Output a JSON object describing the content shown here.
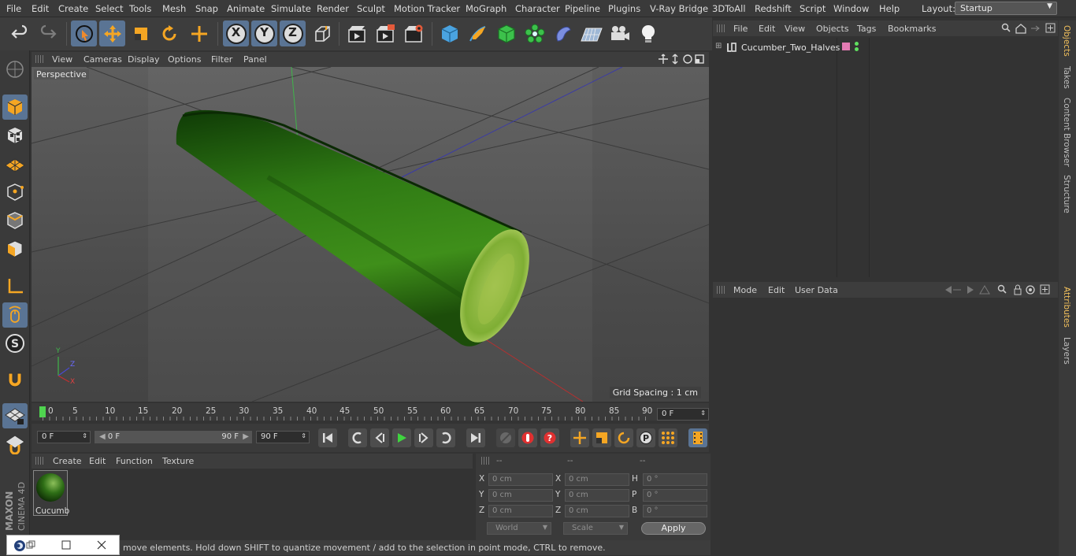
{
  "menubar": {
    "items": [
      "File",
      "Edit",
      "Create",
      "Select",
      "Tools",
      "Mesh",
      "Snap",
      "Animate",
      "Simulate",
      "Render",
      "Sculpt",
      "Motion Tracker",
      "MoGraph",
      "Character",
      "Pipeline",
      "Plugins",
      "V-Ray Bridge",
      "3DToAll",
      "Redshift",
      "Script",
      "Window",
      "Help"
    ],
    "layout_label": "Layout:",
    "layout_value": "Startup"
  },
  "toolbar": {
    "axis_x": "X",
    "axis_y": "Y",
    "axis_z": "Z"
  },
  "viewport": {
    "menu": [
      "View",
      "Cameras",
      "Display",
      "Options",
      "Filter",
      "Panel"
    ],
    "label": "Perspective",
    "grid_spacing": "Grid Spacing : 1 cm",
    "axis_x": "X",
    "axis_y": "Y",
    "axis_z": "Z"
  },
  "timeline": {
    "ticks": [
      "0",
      "5",
      "10",
      "15",
      "20",
      "25",
      "30",
      "35",
      "40",
      "45",
      "50",
      "55",
      "60",
      "65",
      "70",
      "75",
      "80",
      "85",
      "90"
    ],
    "current_frame": "0 F"
  },
  "transport": {
    "start_frame": "0 F",
    "range_start": "0 F",
    "range_end": "90 F",
    "end_frame": "90 F"
  },
  "material_manager": {
    "menu": [
      "Create",
      "Edit",
      "Function",
      "Texture"
    ],
    "material_name": "Cucumb"
  },
  "coordinates": {
    "headers": [
      "--",
      "--",
      "--"
    ],
    "rows": [
      {
        "l1": "X",
        "v1": "0 cm",
        "l2": "X",
        "v2": "0 cm",
        "l3": "H",
        "v3": "0 °"
      },
      {
        "l1": "Y",
        "v1": "0 cm",
        "l2": "Y",
        "v2": "0 cm",
        "l3": "P",
        "v3": "0 °"
      },
      {
        "l1": "Z",
        "v1": "0 cm",
        "l2": "Z",
        "v2": "0 cm",
        "l3": "B",
        "v3": "0 °"
      }
    ],
    "world": "World",
    "scale": "Scale",
    "apply": "Apply"
  },
  "status": "move elements. Hold down SHIFT to quantize movement / add to the selection in point mode, CTRL to remove.",
  "object_manager": {
    "menu": [
      "File",
      "Edit",
      "View",
      "Objects",
      "Tags",
      "Bookmarks"
    ],
    "object_name": "Cucumber_Two_Halves"
  },
  "attribute_manager": {
    "menu": [
      "Mode",
      "Edit",
      "User Data"
    ]
  },
  "right_tabs": [
    "Objects",
    "Takes",
    "Content Browser",
    "Structure"
  ],
  "right_tabs_lower": [
    "Attributes",
    "Layers"
  ],
  "brand": {
    "line1": "MAXON",
    "line2": "CINEMA 4D"
  },
  "colors": {
    "accent": "#5a7494",
    "active_tab": "#f2c05c",
    "play": "#3fd43f",
    "record": "#e03030"
  }
}
